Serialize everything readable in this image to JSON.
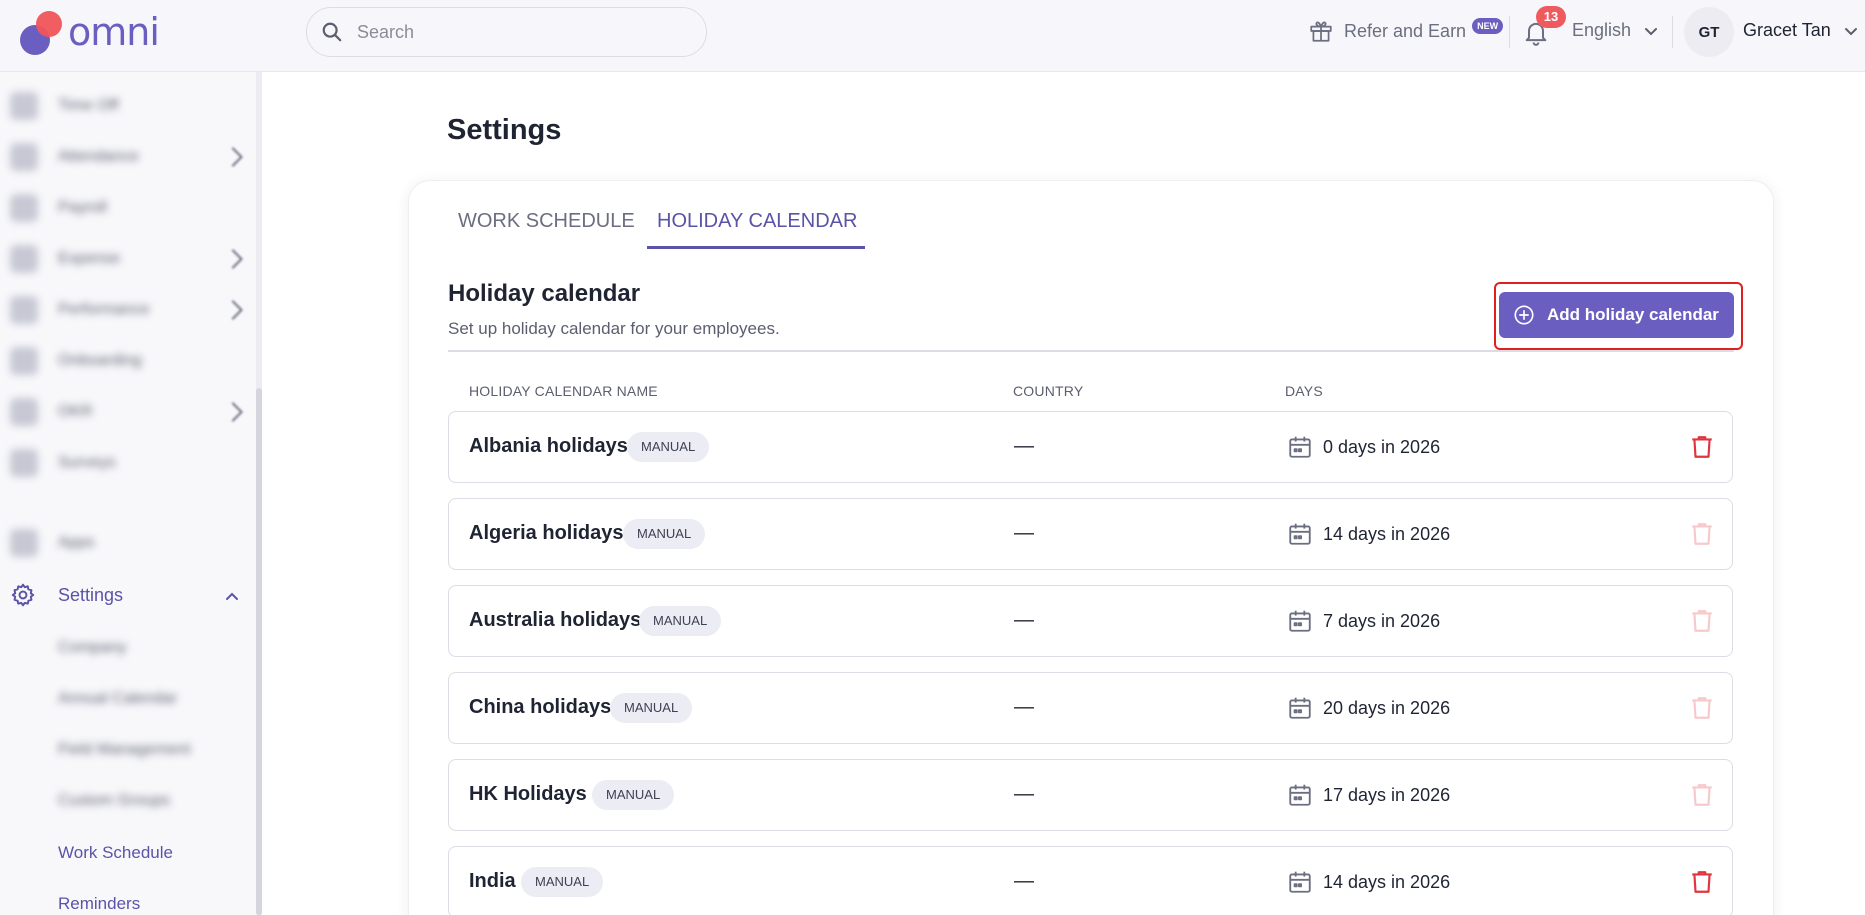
{
  "app": {
    "logo_text": "omni"
  },
  "header": {
    "search_placeholder": "Search",
    "refer_label": "Refer and Earn",
    "new_badge": "NEW",
    "notifications_count": "13",
    "language": "English",
    "avatar_initials": "GT",
    "user_name": "Gracet Tan"
  },
  "sidebar": {
    "blurred_items": [
      "Time Off",
      "Attendance",
      "Payroll",
      "Expense",
      "Performance",
      "Onboarding",
      "OKR",
      "Surveys",
      "Apps"
    ],
    "settings_label": "Settings",
    "sub_blurred": [
      "Company",
      "Annual Calendar",
      "Field Management",
      "Custom Groups"
    ],
    "sub_items": [
      "Work Schedule",
      "Reminders"
    ]
  },
  "main": {
    "page_title": "Settings",
    "tabs": [
      {
        "label": "WORK SCHEDULE",
        "active": false
      },
      {
        "label": "HOLIDAY CALENDAR",
        "active": true
      }
    ],
    "section_title": "Holiday calendar",
    "section_subtitle": "Set up holiday calendar for your employees.",
    "add_button_label": "Add holiday calendar",
    "columns": [
      "HOLIDAY CALENDAR NAME",
      "COUNTRY",
      "DAYS"
    ],
    "rows": [
      {
        "name": "Albania holidays",
        "badge": "MANUAL",
        "country": "—",
        "days": "0 days in 2026",
        "delete_enabled": true
      },
      {
        "name": "Algeria holidays",
        "badge": "MANUAL",
        "country": "—",
        "days": "14 days in 2026",
        "delete_enabled": false
      },
      {
        "name": "Australia holidays",
        "badge": "MANUAL",
        "country": "—",
        "days": "7 days in 2026",
        "delete_enabled": false
      },
      {
        "name": "China holidays",
        "badge": "MANUAL",
        "country": "—",
        "days": "20 days in 2026",
        "delete_enabled": false
      },
      {
        "name": "HK Holidays",
        "badge": "MANUAL",
        "country": "—",
        "days": "17 days in 2026",
        "delete_enabled": false
      },
      {
        "name": "India",
        "badge": "MANUAL",
        "country": "—",
        "days": "14 days in 2026",
        "delete_enabled": true
      }
    ]
  },
  "colors": {
    "accent": "#6a5fc1",
    "accent_text": "#5a53a8",
    "danger": "#e0353f",
    "danger_disabled": "#f7c9cb",
    "highlight_outline": "#e02020"
  },
  "icons": {
    "search": "search-icon",
    "gift": "gift-icon",
    "bell": "bell-icon",
    "chevron": "chevron-down-icon",
    "gear": "gear-icon",
    "add": "plus-circle-icon",
    "calendar": "calendar-icon",
    "trash": "trash-icon"
  }
}
